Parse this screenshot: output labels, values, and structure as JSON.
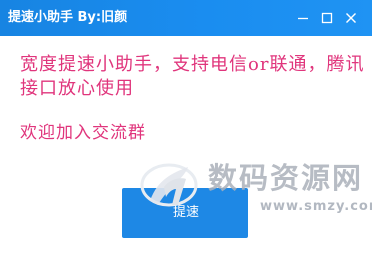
{
  "window": {
    "title": "提速小助手 By:旧颜",
    "controls": {
      "minimize_icon": "minimize-icon",
      "maximize_icon": "maximize-icon",
      "close_icon": "close-icon"
    }
  },
  "content": {
    "message": "宽度提速小助手，支持电信or联通，腾讯接口放心使用",
    "group_text": "欢迎加入交流群",
    "action_button_label": "提速"
  },
  "watermark": {
    "name": "数码资源网",
    "url": "www.smzy.com",
    "logo_icon": "smzy-logo-icon"
  },
  "colors": {
    "titlebar": "#1a8df0",
    "message_text": "#e0357c",
    "button": "#1e88e5",
    "watermark": "#aab0ba"
  }
}
